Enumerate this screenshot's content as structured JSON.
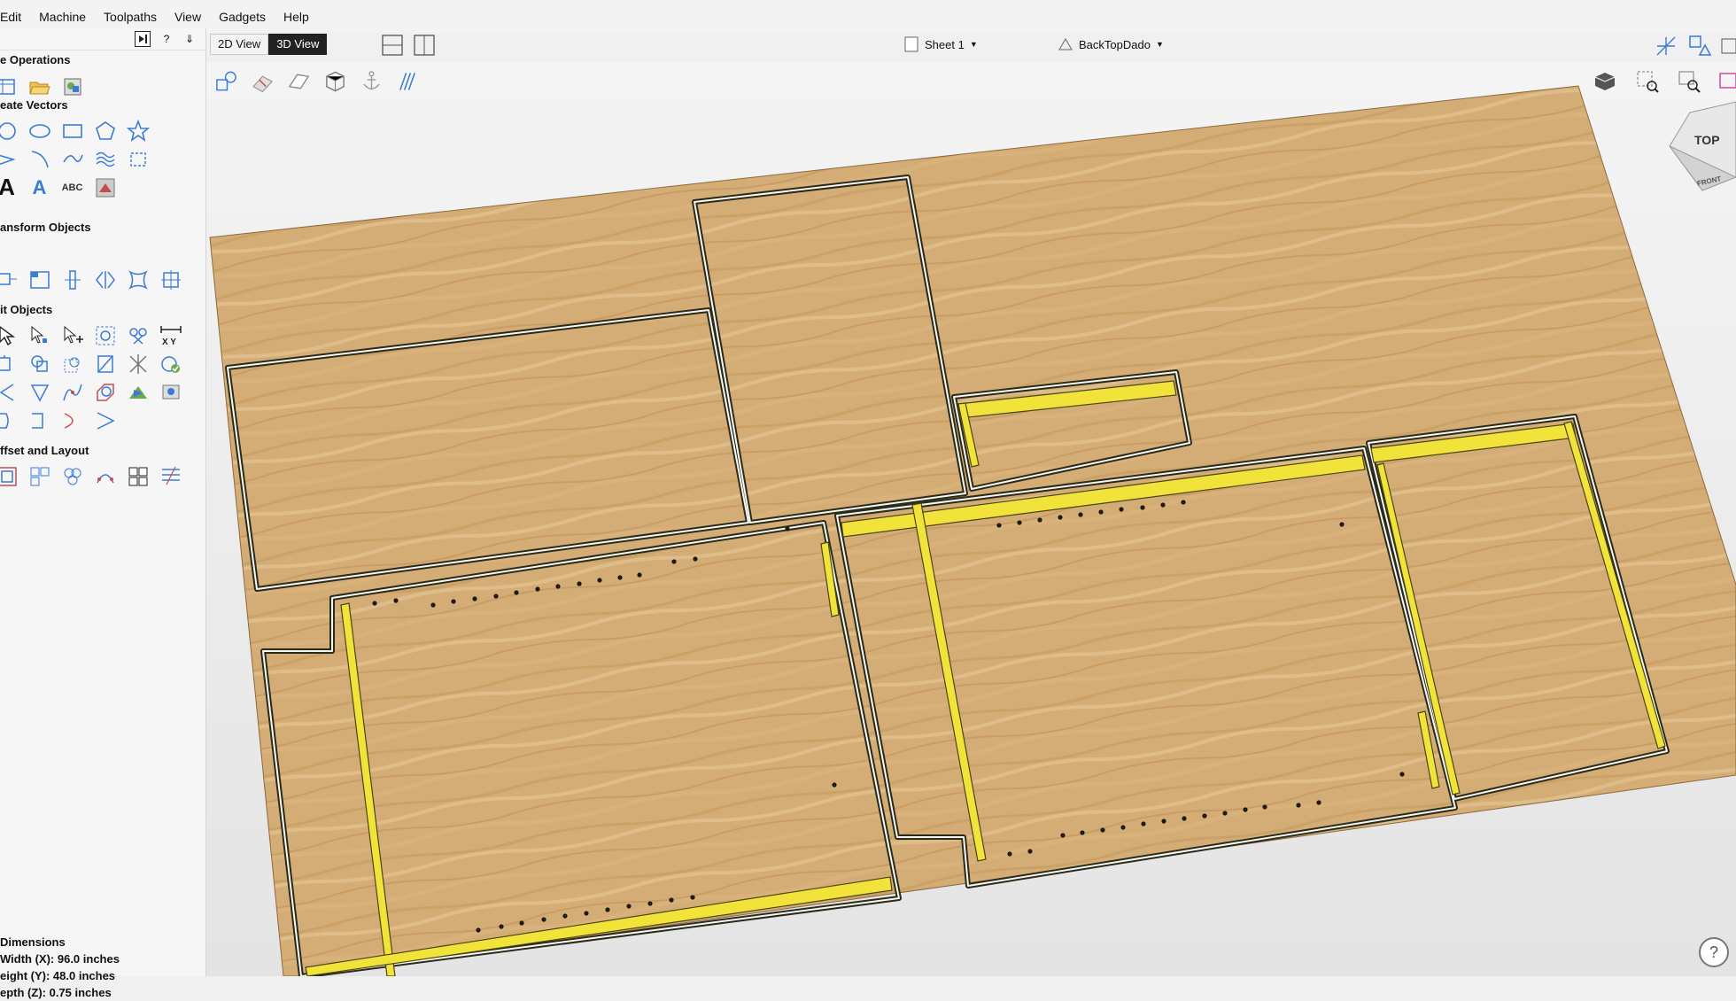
{
  "menu": [
    "Edit",
    "Machine",
    "Toolpaths",
    "View",
    "Gadgets",
    "Help"
  ],
  "panel_header": {
    "pin_label": "?",
    "push_label": "⇓"
  },
  "sections": {
    "file_ops": "e Operations",
    "create_vectors": "eate Vectors",
    "transform": "ansform Objects",
    "edit": "it Objects",
    "offset": "ffset and Layout"
  },
  "text_tools": {
    "text": "A",
    "auto": "A",
    "abc": "ABC"
  },
  "dimensions": {
    "title": "Dimensions",
    "width": "Width  (X): 96.0 inches",
    "height": "eight (Y): 48.0 inches",
    "depth": "epth  (Z): 0.75 inches"
  },
  "toolbar": {
    "view2d": "2D View",
    "view3d": "3D View",
    "sheet": "Sheet 1",
    "toolpath": "BackTopDado"
  },
  "cube": {
    "top": "TOP",
    "front": "FRONT"
  },
  "help_label": "?",
  "colors": {
    "wood": "#d4ad76",
    "dado": "#f1e33a",
    "outline": "#2a2a1a"
  }
}
